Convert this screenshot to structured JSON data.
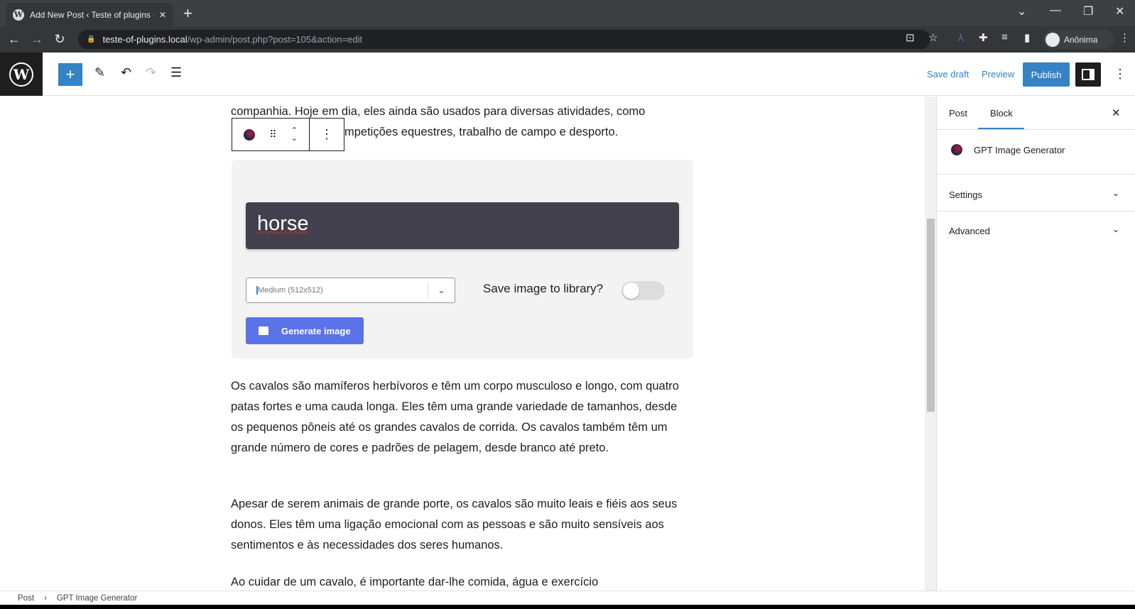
{
  "browser": {
    "tab_title": "Add New Post ‹ Teste of plugins –",
    "url_domain": "teste-of-plugins.local",
    "url_path": "/wp-admin/post.php?post=105&action=edit",
    "profile": "Anônima"
  },
  "header": {
    "save_draft": "Save draft",
    "preview": "Preview",
    "publish": "Publish"
  },
  "content": {
    "para_top_1": "companhia. Hoje em dia, eles ainda são usados para diversas atividades, como",
    "para_top_2": "mpetições equestres, trabalho de campo e desporto.",
    "block": {
      "prompt": "horse",
      "size_value": "Medium (512x512)",
      "save_label": "Save image to library?",
      "save_enabled": false,
      "generate_label": "Generate image"
    },
    "para_1": "Os cavalos são mamíferos herbívoros e têm um corpo musculoso e longo, com quatro patas fortes e uma cauda longa. Eles têm uma grande variedade de tamanhos, desde os pequenos pôneis até os grandes cavalos de corrida. Os cavalos também têm um grande número de cores e padrões de pelagem, desde branco até preto.",
    "para_2": "Apesar de serem animais de grande porte, os cavalos são muito leais e fiéis aos seus donos. Eles têm uma ligação emocional com as pessoas e são muito sensíveis aos sentimentos e às necessidades dos seres humanos.",
    "para_3": "Ao cuidar de um cavalo, é importante dar-lhe comida, água e exercício"
  },
  "sidebar": {
    "tabs": [
      "Post",
      "Block"
    ],
    "active_tab": "Block",
    "block_name": "GPT Image Generator",
    "sections": [
      "Settings",
      "Advanced"
    ]
  },
  "breadcrumb": [
    "Post",
    "GPT Image Generator"
  ],
  "colors": {
    "accent": "#3582c4",
    "generate": "#5b73e8",
    "prompt_bg": "#43404d"
  }
}
